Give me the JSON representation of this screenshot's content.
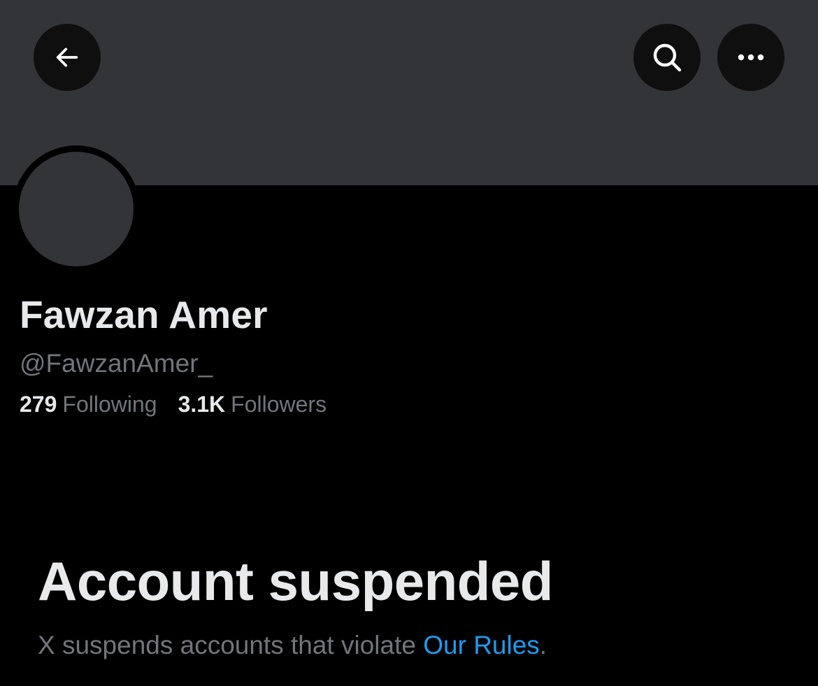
{
  "header": {
    "back_icon": "arrow-left-icon",
    "search_icon": "search-icon",
    "more_icon": "more-horizontal-icon"
  },
  "profile": {
    "display_name": "Fawzan Amer",
    "handle": "@FawzanAmer_",
    "following_count": "279",
    "following_label": "Following",
    "followers_count": "3.1K",
    "followers_label": "Followers"
  },
  "suspension": {
    "title": "Account suspended",
    "description_prefix": "X suspends accounts that violate ",
    "link_text": "Our Rules",
    "description_suffix": "."
  },
  "colors": {
    "background": "#000000",
    "banner": "#333438",
    "button_bg": "#0f0f10",
    "primary_text": "#e7e9ea",
    "secondary_text": "#71767b",
    "link": "#1d9bf0"
  }
}
